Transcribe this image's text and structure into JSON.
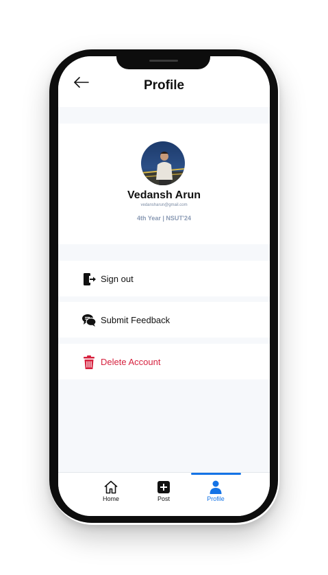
{
  "header": {
    "title": "Profile"
  },
  "profile": {
    "name": "Vedansh Arun",
    "email": "vedansharun@gmail.com",
    "year_college": "4th Year | NSUT'24"
  },
  "menu": [
    {
      "label": "Sign out",
      "icon": "sign-out-icon"
    },
    {
      "label": "Submit Feedback",
      "icon": "feedback-icon"
    },
    {
      "label": "Delete Account",
      "icon": "trash-icon"
    }
  ],
  "tabs": [
    {
      "label": "Home",
      "icon": "home-icon"
    },
    {
      "label": "Post",
      "icon": "plus-square-icon"
    },
    {
      "label": "Profile",
      "icon": "person-icon",
      "active": true
    }
  ],
  "colors": {
    "accent": "#1473e6",
    "danger": "#d6213e",
    "muted": "#8a9ab4"
  }
}
